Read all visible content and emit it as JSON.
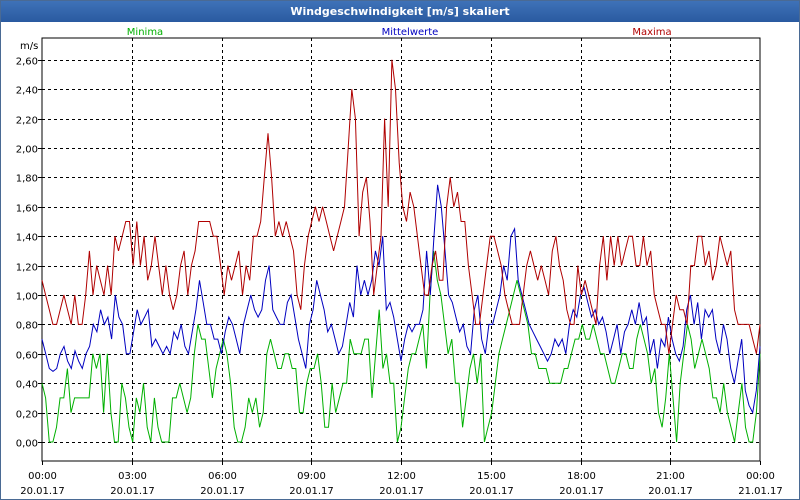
{
  "window": {
    "title": "Windgeschwindigkeit [m/s] skaliert"
  },
  "chart_data": {
    "type": "line",
    "title": "Windgeschwindigkeit [m/s] skaliert",
    "ylabel": "m/s",
    "ylim": [
      0,
      2.7
    ],
    "yticks": [
      "0,00",
      "0,20",
      "0,40",
      "0,60",
      "0,80",
      "1,00",
      "1,20",
      "1,40",
      "1,60",
      "1,80",
      "2,00",
      "2,20",
      "2,40",
      "2,60"
    ],
    "xticks": [
      {
        "time": "00:00",
        "date": "20.01.17"
      },
      {
        "time": "03:00",
        "date": "20.01.17"
      },
      {
        "time": "06:00",
        "date": "20.01.17"
      },
      {
        "time": "09:00",
        "date": "20.01.17"
      },
      {
        "time": "12:00",
        "date": "20.01.17"
      },
      {
        "time": "15:00",
        "date": "20.01.17"
      },
      {
        "time": "18:00",
        "date": "20.01.17"
      },
      {
        "time": "21:00",
        "date": "20.01.17"
      },
      {
        "time": "00:00",
        "date": "21.01.17"
      }
    ],
    "grid": true,
    "legend_position": "top",
    "x_unit": "hours",
    "series": [
      {
        "name": "Minima",
        "color": "#00b000",
        "values": [
          0.4,
          0.3,
          0,
          0,
          0.1,
          0.3,
          0.3,
          0.5,
          0.2,
          0.3,
          0.3,
          0.3,
          0.3,
          0.3,
          0.6,
          0.5,
          0.6,
          0.2,
          0.6,
          0.2,
          0,
          0,
          0.4,
          0.3,
          0.1,
          0,
          0.3,
          0.2,
          0.4,
          0.1,
          0,
          0.3,
          0.1,
          0,
          0,
          0,
          0.3,
          0.3,
          0.4,
          0.3,
          0.2,
          0.3,
          0.6,
          0.8,
          0.7,
          0.7,
          0.5,
          0.3,
          0.5,
          0.6,
          0.7,
          0.6,
          0.4,
          0.1,
          0,
          0,
          0.1,
          0.3,
          0.2,
          0.3,
          0.1,
          0.2,
          0.6,
          0.7,
          0.6,
          0.5,
          0.5,
          0.6,
          0.6,
          0.5,
          0.5,
          0.2,
          0.2,
          0.4,
          0.5,
          0.5,
          0.6,
          0.4,
          0.1,
          0.1,
          0.4,
          0.2,
          0.3,
          0.4,
          0.4,
          0.7,
          0.6,
          0.6,
          0.6,
          0.7,
          0.7,
          0.3,
          0.6,
          0.9,
          0.5,
          0.6,
          0.4,
          0.4,
          0,
          0.1,
          0.3,
          0.5,
          0.6,
          0.6,
          0.7,
          0.8,
          0.5,
          1.0,
          1.3,
          1.1,
          1.0,
          0.8,
          0.6,
          0.7,
          0.4,
          0.4,
          0.1,
          0.3,
          0.5,
          0.6,
          0.4,
          0.6,
          0,
          0.1,
          0.2,
          0.4,
          0.6,
          0.7,
          0.8,
          0.9,
          1.0,
          1.1,
          1.0,
          0.9,
          0.8,
          0.6,
          0.6,
          0.5,
          0.5,
          0.5,
          0.4,
          0.4,
          0.4,
          0.4,
          0.5,
          0.5,
          0.6,
          0.7,
          0.7,
          0.8,
          0.7,
          0.7,
          0.8,
          0.7,
          0.6,
          0.6,
          0.5,
          0.4,
          0.4,
          0.5,
          0.6,
          0.6,
          0.5,
          0.5,
          0.7,
          0.8,
          0.7,
          0.6,
          0.4,
          0.5,
          0.2,
          0.1,
          0.3,
          0.6,
          0.3,
          0,
          0.4,
          0.6,
          0.8,
          0.7,
          0.5,
          0.6,
          0.7,
          0.6,
          0.5,
          0.3,
          0.3,
          0.2,
          0.4,
          0.2,
          0.1,
          0,
          0.2,
          0.4,
          0.1,
          0,
          0,
          0.2,
          0.6
        ]
      },
      {
        "name": "Mittelwerte",
        "color": "#0000c0",
        "values": [
          0.7,
          0.6,
          0.5,
          0.48,
          0.5,
          0.6,
          0.65,
          0.55,
          0.5,
          0.62,
          0.55,
          0.5,
          0.6,
          0.65,
          0.8,
          0.75,
          0.9,
          0.8,
          0.85,
          0.7,
          1.0,
          0.85,
          0.8,
          0.6,
          0.6,
          0.75,
          0.9,
          0.8,
          0.85,
          0.9,
          0.65,
          0.7,
          0.65,
          0.6,
          0.65,
          0.6,
          0.75,
          0.7,
          0.8,
          0.65,
          0.6,
          0.75,
          0.9,
          1.1,
          0.95,
          0.8,
          0.8,
          0.7,
          0.7,
          0.6,
          0.75,
          0.85,
          0.8,
          0.7,
          0.6,
          0.8,
          0.9,
          1.0,
          0.9,
          0.85,
          0.9,
          1.1,
          1.2,
          0.9,
          0.85,
          0.8,
          0.8,
          0.95,
          1.0,
          0.85,
          0.7,
          0.6,
          0.5,
          0.8,
          0.9,
          1.1,
          1.0,
          0.9,
          0.75,
          0.8,
          0.7,
          0.6,
          0.65,
          0.8,
          0.95,
          0.85,
          1.2,
          1.0,
          1.1,
          1.0,
          1.1,
          1.3,
          1.2,
          1.4,
          0.9,
          0.95,
          0.85,
          0.7,
          0.55,
          0.7,
          0.8,
          0.75,
          0.8,
          0.8,
          0.9,
          1.3,
          1.0,
          1.4,
          1.75,
          1.6,
          1.3,
          1.0,
          0.95,
          0.85,
          0.75,
          0.8,
          0.65,
          0.6,
          0.9,
          1.0,
          0.7,
          0.6,
          0.8,
          0.8,
          0.9,
          1.0,
          1.2,
          1.1,
          1.4,
          1.45,
          1.1,
          1.0,
          0.9,
          0.8,
          0.75,
          0.7,
          0.65,
          0.6,
          0.55,
          0.6,
          0.7,
          0.65,
          0.7,
          0.6,
          0.8,
          0.9,
          0.85,
          1.0,
          1.05,
          0.95,
          0.85,
          0.9,
          0.8,
          0.85,
          0.75,
          0.6,
          0.7,
          0.8,
          0.6,
          0.75,
          0.8,
          0.9,
          0.8,
          0.95,
          0.8,
          0.85,
          0.6,
          0.7,
          0.5,
          0.7,
          0.65,
          0.85,
          0.7,
          0.6,
          0.55,
          0.65,
          0.9,
          1.0,
          0.8,
          0.95,
          0.7,
          0.9,
          0.85,
          0.9,
          0.7,
          0.6,
          0.8,
          0.7,
          0.5,
          0.4,
          0.55,
          0.7,
          0.35,
          0.25,
          0.2,
          0.35,
          0.65
        ]
      },
      {
        "name": "Maxima",
        "color": "#b00000",
        "values": [
          1.1,
          1.0,
          0.9,
          0.8,
          0.8,
          0.9,
          1.0,
          0.9,
          0.8,
          1.0,
          0.8,
          0.8,
          1.0,
          1.3,
          1.0,
          1.2,
          1.1,
          1.0,
          1.2,
          1.0,
          1.4,
          1.3,
          1.4,
          1.5,
          1.5,
          1.2,
          1.5,
          1.2,
          1.4,
          1.1,
          1.2,
          1.4,
          1.2,
          1.0,
          1.2,
          1.0,
          0.9,
          1.0,
          1.2,
          1.3,
          1.0,
          1.2,
          1.3,
          1.5,
          1.5,
          1.5,
          1.5,
          1.4,
          1.4,
          1.2,
          1.0,
          1.2,
          1.1,
          1.2,
          1.3,
          1.0,
          1.2,
          1.1,
          1.4,
          1.4,
          1.5,
          1.8,
          2.1,
          1.8,
          1.4,
          1.5,
          1.4,
          1.5,
          1.4,
          1.3,
          1.0,
          0.9,
          1.2,
          1.4,
          1.5,
          1.6,
          1.5,
          1.6,
          1.5,
          1.4,
          1.3,
          1.4,
          1.5,
          1.6,
          2.0,
          2.4,
          2.2,
          1.4,
          1.7,
          1.8,
          1.5,
          1.0,
          1.2,
          1.4,
          2.2,
          1.6,
          2.6,
          2.4,
          1.9,
          1.6,
          1.5,
          1.7,
          1.6,
          1.4,
          1.2,
          1.0,
          1.0,
          1.2,
          1.3,
          1.1,
          1.1,
          1.6,
          1.8,
          1.6,
          1.7,
          1.5,
          1.5,
          1.2,
          1.0,
          0.8,
          0.8,
          1.0,
          1.2,
          1.4,
          1.4,
          1.3,
          1.2,
          1.0,
          0.9,
          0.8,
          0.8,
          0.8,
          1.0,
          1.2,
          1.3,
          1.2,
          1.1,
          1.2,
          1.1,
          1.0,
          1.3,
          1.4,
          1.2,
          1.1,
          0.9,
          0.8,
          0.8,
          1.2,
          1.0,
          1.1,
          1.0,
          0.9,
          0.8,
          1.2,
          1.4,
          1.1,
          1.4,
          1.2,
          1.4,
          1.2,
          1.3,
          1.4,
          1.4,
          1.2,
          1.2,
          1.4,
          1.2,
          1.3,
          1.0,
          0.9,
          0.8,
          0.8,
          0.6,
          0.8,
          1.0,
          0.9,
          0.9,
          0.8,
          1.2,
          1.2,
          1.4,
          1.4,
          1.2,
          1.3,
          1.1,
          1.2,
          1.4,
          1.3,
          1.2,
          1.3,
          0.9,
          0.8,
          0.8,
          0.8,
          0.8,
          0.7,
          0.6,
          0.8
        ]
      }
    ]
  }
}
